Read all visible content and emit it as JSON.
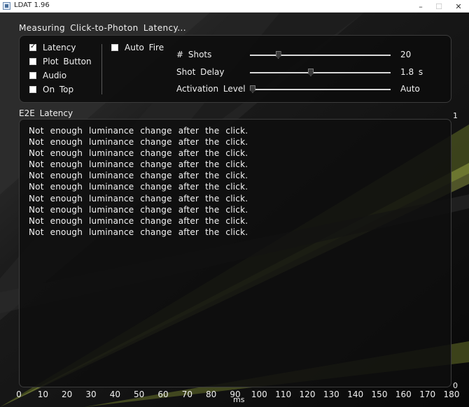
{
  "window": {
    "title": "LDAT 1.96",
    "minimize_glyph": "–",
    "maximize_glyph": "☐",
    "close_glyph": "✕"
  },
  "heading": "Measuring Click-to-Photon Latency...",
  "checkboxes": [
    {
      "label": "Latency",
      "checked": true
    },
    {
      "label": "Plot Button",
      "checked": false
    },
    {
      "label": "Audio",
      "checked": false
    },
    {
      "label": "On Top",
      "checked": false
    }
  ],
  "auto_fire": {
    "label": "Auto Fire",
    "checked": false
  },
  "settings": [
    {
      "label": "# Shots",
      "value": "20",
      "level": 0.19
    },
    {
      "label": "Shot Delay",
      "value": "1.8 s",
      "level": 0.43
    },
    {
      "label": "Activation Level",
      "value": "Auto",
      "level": 0.0
    }
  ],
  "plot": {
    "title": "E2E Latency",
    "messages": [
      "Not enough luminance change after the click.",
      "Not enough luminance change after the click.",
      "Not enough luminance change after the click.",
      "Not enough luminance change after the click.",
      "Not enough luminance change after the click.",
      "Not enough luminance change after the click.",
      "Not enough luminance change after the click.",
      "Not enough luminance change after the click.",
      "Not enough luminance change after the click.",
      "Not enough luminance change after the click."
    ],
    "y_max_label": "1",
    "y_min_label": "0",
    "x_ticks": [
      "0",
      "10",
      "20",
      "30",
      "40",
      "50",
      "60",
      "70",
      "80",
      "90",
      "100",
      "110",
      "120",
      "130",
      "140",
      "150",
      "160",
      "170",
      "180"
    ],
    "x_axis_label": "ms"
  },
  "colors": {
    "background": "#0b0b0b",
    "accent_green": "#c8d85a"
  }
}
